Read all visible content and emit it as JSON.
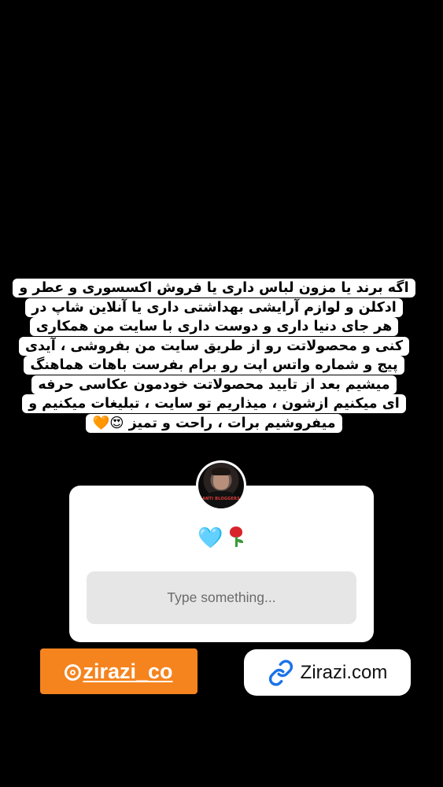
{
  "story": {
    "caption_lines": [
      "اگه برند یا مزون لباس داری یا فروش اکسسوری و عطر و",
      "ادکلن و لوازم آرایشی بهداشتی داری یا آنلاین شاپ در",
      "هر جای دنیا داری و دوست داری با سایت من همکاری",
      "کنی و محصولاتت رو از طریق سایت من بفروشی ، آیدی",
      "پیج و شماره واتس اپت رو برام بفرست باهات هماهنگ",
      "میشیم بعد از تایید محصولاتت خودمون عکاسی حرفه",
      "ای میکنیم ازشون ، میذاریم تو سایت ، تبلیغات میکنیم و",
      "میفروشیم برات ، راحت و تمیز 😍🧡"
    ]
  },
  "question_sticker": {
    "avatar_text": "ANTI BLOGGERS",
    "prompt_emojis": "🩵",
    "reply_placeholder": "Type something..."
  },
  "mention_sticker": {
    "handle": "zirazi_co",
    "color": "#f5841f"
  },
  "link_sticker": {
    "label": "Zirazi.com",
    "icon": "link-icon",
    "color": "#1a73e8"
  }
}
